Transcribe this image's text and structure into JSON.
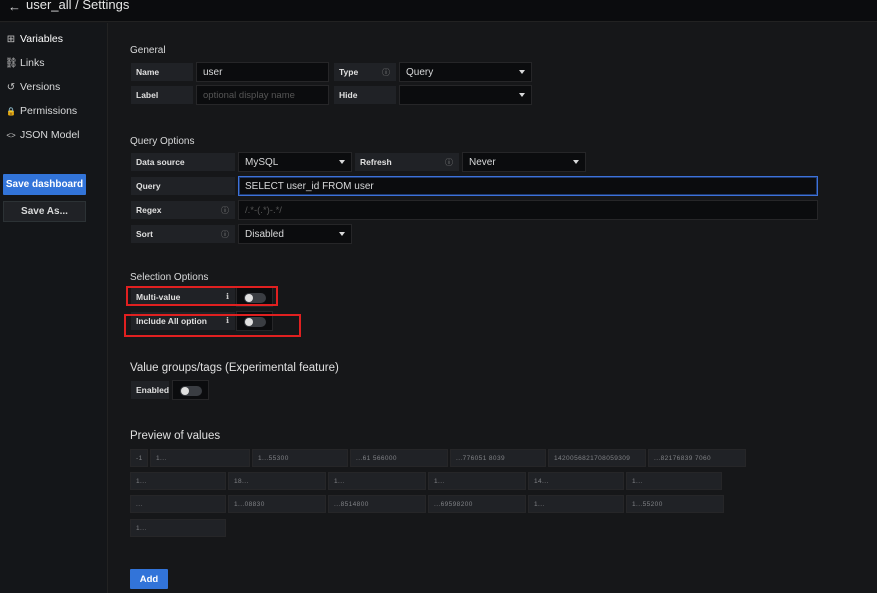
{
  "header": {
    "title": "user_all / Settings",
    "back_icon": "back-arrow-icon"
  },
  "sidebar": {
    "items": [
      {
        "label": "Variables",
        "icon": "variables-icon",
        "glyph": "⊞"
      },
      {
        "label": "Links",
        "icon": "link-icon",
        "glyph": "⛓"
      },
      {
        "label": "Versions",
        "icon": "history-icon",
        "glyph": "↺"
      },
      {
        "label": "Permissions",
        "icon": "lock-icon",
        "glyph": "🔒"
      },
      {
        "label": "JSON Model",
        "icon": "code-icon",
        "glyph": "<>"
      }
    ],
    "save_dashboard": "Save dashboard",
    "save_as": "Save As..."
  },
  "general": {
    "heading": "General",
    "name_label": "Name",
    "name_value": "user",
    "type_label": "Type",
    "type_value": "Query",
    "label_label": "Label",
    "label_placeholder": "optional display name",
    "hide_label": "Hide",
    "hide_value": ""
  },
  "query_options": {
    "heading": "Query Options",
    "datasource_label": "Data source",
    "datasource_value": "MySQL",
    "refresh_label": "Refresh",
    "refresh_value": "Never",
    "query_label": "Query",
    "query_value": "SELECT user_id FROM user",
    "regex_label": "Regex",
    "regex_placeholder": "/.*-(.*)-.*/",
    "sort_label": "Sort",
    "sort_value": "Disabled"
  },
  "selection_options": {
    "heading": "Selection Options",
    "multi_value_label": "Multi-value",
    "multi_value_on": false,
    "include_all_label": "Include All option",
    "include_all_on": false
  },
  "value_groups": {
    "heading": "Value groups/tags (Experimental feature)",
    "enabled_label": "Enabled",
    "enabled_on": false
  },
  "preview": {
    "heading": "Preview of values",
    "values": [
      "-1",
      "1...",
      "1...55300",
      "...61 566000",
      "...776051 8039",
      "1420056821708059309",
      "...82176839 7060",
      "1...",
      "18...",
      "1...",
      "1...",
      "14...",
      "1...",
      "...",
      "1...08830",
      "...8514800",
      "...69598200",
      "1...",
      "1...55200",
      "1..."
    ]
  },
  "add_button": "Add"
}
